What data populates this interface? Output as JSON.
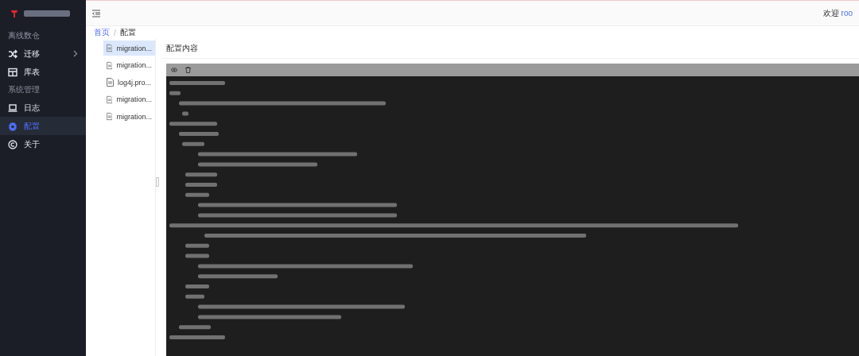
{
  "header": {
    "welcome": "欢迎",
    "user": "roo"
  },
  "sidebar": {
    "items": [
      {
        "kind": "group",
        "label": "离线数仓"
      },
      {
        "kind": "item",
        "label": "迁移",
        "expandable": true,
        "selected": false
      },
      {
        "kind": "item",
        "label": "库表",
        "expandable": false,
        "selected": false
      },
      {
        "kind": "group",
        "label": "系统管理"
      },
      {
        "kind": "item",
        "label": "日志",
        "expandable": false,
        "selected": false
      },
      {
        "kind": "item",
        "label": "配置",
        "expandable": false,
        "selected": true
      },
      {
        "kind": "item",
        "label": "关于",
        "expandable": false,
        "selected": false
      }
    ]
  },
  "breadcrumb": {
    "items": [
      "首页",
      "配置"
    ],
    "separator": "/"
  },
  "files": [
    {
      "name": "migration...",
      "selected": true
    },
    {
      "name": "migration...",
      "selected": false
    },
    {
      "name": "log4j.pro...",
      "selected": false
    },
    {
      "name": "migration...",
      "selected": false
    },
    {
      "name": "migration...",
      "selected": false
    }
  ],
  "panel": {
    "title": "配置内容"
  }
}
